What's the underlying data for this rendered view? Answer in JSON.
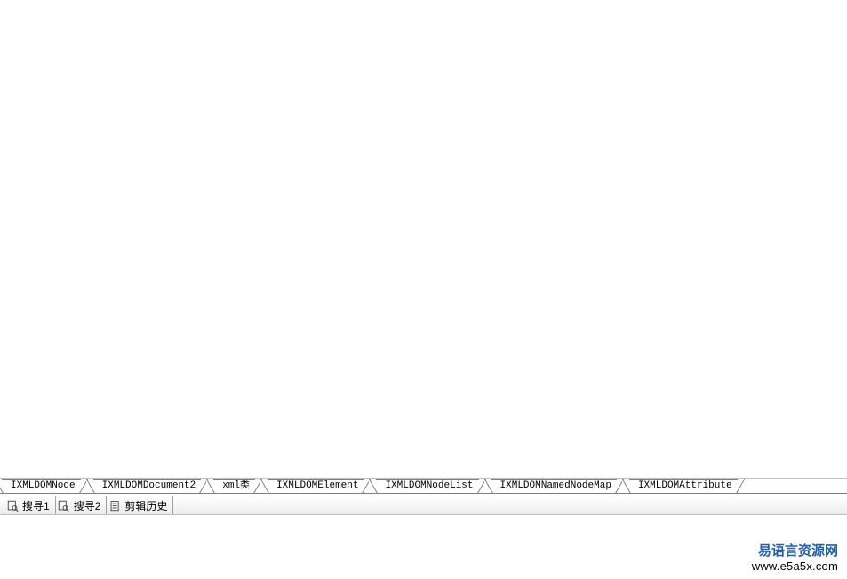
{
  "tabs_row1": [
    {
      "label": "IXMLDOMNode"
    },
    {
      "label": "IXMLDOMDocument2"
    },
    {
      "label": "xml类"
    },
    {
      "label": "IXMLDOMElement"
    },
    {
      "label": "IXMLDOMNodeList"
    },
    {
      "label": "IXMLDOMNamedNodeMap"
    },
    {
      "label": "IXMLDOMAttribute"
    }
  ],
  "lower_tabs": [
    {
      "label": "搜寻1",
      "icon": "search-icon"
    },
    {
      "label": "搜寻2",
      "icon": "search-icon"
    },
    {
      "label": "剪辑历史",
      "icon": "clipboard-icon"
    }
  ],
  "watermark": {
    "title": "易语言资源网",
    "url": "www.e5a5x.com"
  }
}
